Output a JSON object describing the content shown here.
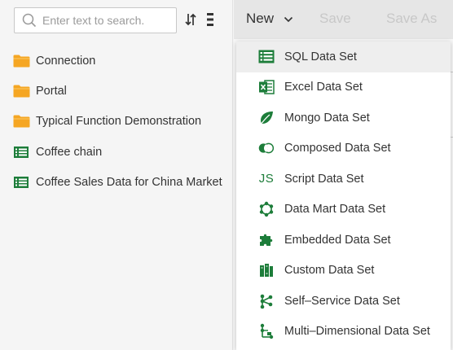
{
  "search": {
    "placeholder": "Enter text to search."
  },
  "tree": {
    "items": [
      {
        "label": "Connection",
        "icon": "folder-icon"
      },
      {
        "label": "Portal",
        "icon": "folder-icon"
      },
      {
        "label": "Typical Function Demonstration",
        "icon": "folder-icon"
      },
      {
        "label": "Coffee chain",
        "icon": "table-icon"
      },
      {
        "label": "Coffee Sales Data for China Market",
        "icon": "table-icon"
      }
    ]
  },
  "toolbar": {
    "new_label": "New",
    "save_label": "Save",
    "save_as_label": "Save As"
  },
  "menu": {
    "items": [
      {
        "label": "SQL Data Set",
        "icon": "sql-table-icon"
      },
      {
        "label": "Excel Data Set",
        "icon": "excel-icon"
      },
      {
        "label": "Mongo Data Set",
        "icon": "mongo-leaf-icon"
      },
      {
        "label": "Composed Data Set",
        "icon": "composed-circles-icon"
      },
      {
        "label": "Script Data Set",
        "icon": "js-icon",
        "icon_text": "JS"
      },
      {
        "label": "Data Mart Data Set",
        "icon": "data-mart-icon"
      },
      {
        "label": "Embedded Data Set",
        "icon": "puzzle-icon"
      },
      {
        "label": "Custom Data Set",
        "icon": "custom-books-icon"
      },
      {
        "label": "Self–Service Data Set",
        "icon": "self-service-icon"
      },
      {
        "label": "Multi–Dimensional Data Set",
        "icon": "multi-dimensional-icon"
      }
    ]
  },
  "colors": {
    "folder": "#f5a623",
    "icon_green": "#1d7d3a",
    "toolbar_bg": "#e6e6e6"
  }
}
